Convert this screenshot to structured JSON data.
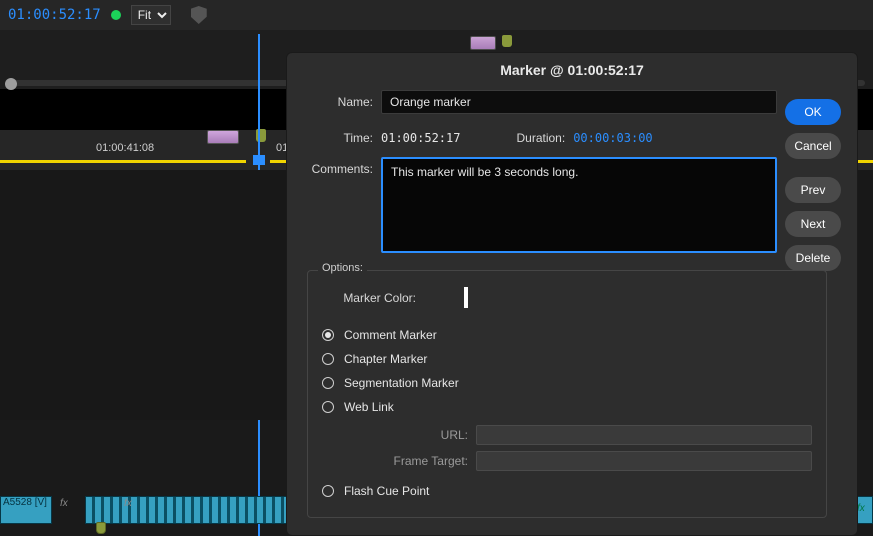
{
  "topbar": {
    "timecode": "01:00:52:17",
    "zoom_label": "Fit"
  },
  "timeline": {
    "ruler_label_1": "01:00:41:08",
    "ruler_label_2": "01:",
    "clip_label": "A5528 [V]",
    "fx_label": "fx"
  },
  "dialog": {
    "title": "Marker @ 01:00:52:17",
    "name_label": "Name:",
    "name_value": "Orange marker",
    "time_label": "Time:",
    "time_value": "01:00:52:17",
    "duration_label": "Duration:",
    "duration_value": "00:00:03:00",
    "comments_label": "Comments:",
    "comments_value": "This marker will be 3 seconds long.",
    "buttons": {
      "ok": "OK",
      "cancel": "Cancel",
      "prev": "Prev",
      "next": "Next",
      "delete": "Delete"
    },
    "options_label": "Options:",
    "marker_color_label": "Marker Color:",
    "marker_colors": [
      "#7d8b2d",
      "#d0403f",
      "#b893c2",
      "#e07318",
      "#d1a92e",
      "#ffffff",
      "#3d68d4",
      "#23c9a7"
    ],
    "marker_color_selected_index": 3,
    "radios": {
      "comment": "Comment Marker",
      "chapter": "Chapter Marker",
      "segmentation": "Segmentation Marker",
      "weblink": "Web Link",
      "flash": "Flash Cue Point"
    },
    "radio_selected": "comment",
    "url_label": "URL:",
    "frame_target_label": "Frame Target:"
  }
}
